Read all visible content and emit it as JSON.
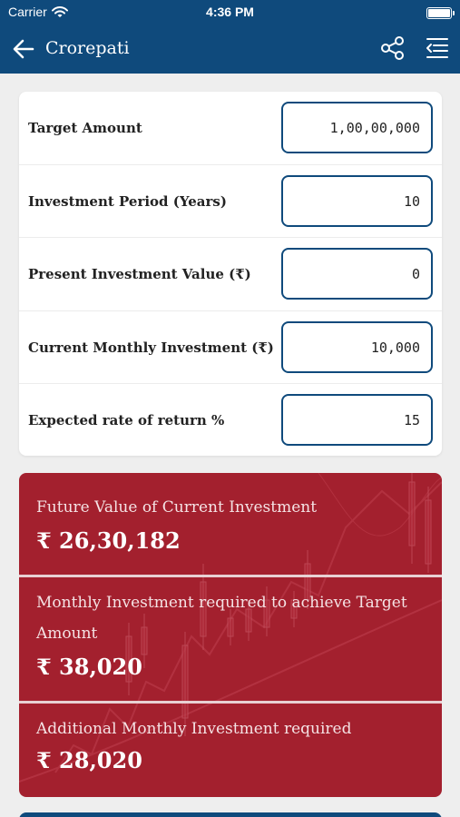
{
  "status_bar": {
    "carrier": "Carrier",
    "time": "4:36 PM"
  },
  "app_bar": {
    "title": "Crorepati",
    "back_icon": "arrow-left-icon",
    "share_icon": "share-icon",
    "menu_icon": "menu-collapse-icon"
  },
  "form": {
    "fields": [
      {
        "label": "Target Amount",
        "value": "1,00,00,000"
      },
      {
        "label": "Investment Period (Years)",
        "value": "10"
      },
      {
        "label": "Present Investment Value (₹)",
        "value": "0"
      },
      {
        "label": "Current Monthly Investment (₹)",
        "value": "10,000"
      },
      {
        "label": "Expected rate of return %",
        "value": "15"
      }
    ]
  },
  "results": [
    {
      "label": "Future Value of Current Investment",
      "value": "₹ 26,30,182"
    },
    {
      "label": "Monthly Investment required to achieve Target Amount",
      "value": "₹ 38,020"
    },
    {
      "label": "Additional Monthly Investment required",
      "value": "₹ 28,020"
    }
  ],
  "colors": {
    "primary": "#0f4a7c",
    "result_bg": "#a3202e",
    "page_bg": "#eeeeee"
  }
}
